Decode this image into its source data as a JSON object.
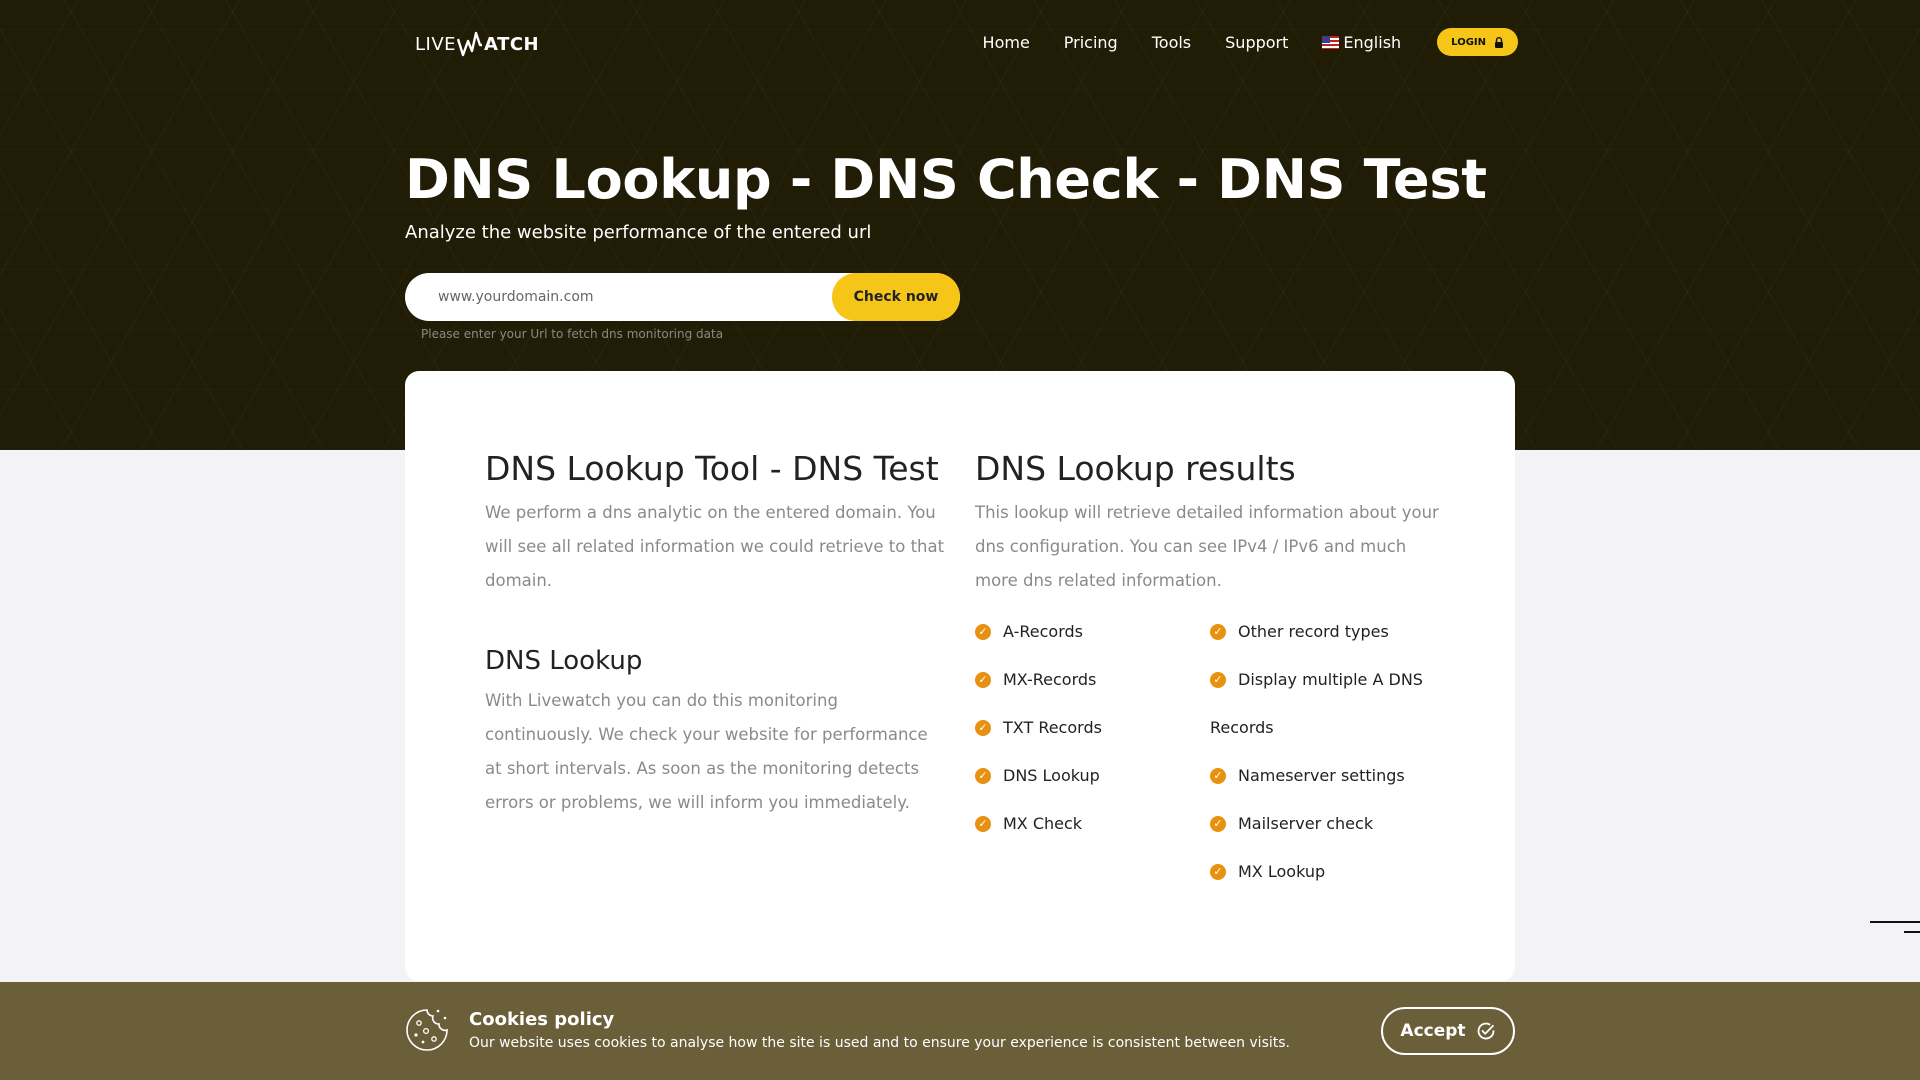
{
  "header": {
    "logo": {
      "part1": "LIVE",
      "part2": "ATCH"
    },
    "nav": [
      "Home",
      "Pricing",
      "Tools",
      "Support"
    ],
    "language": "English",
    "login_label": "LOGIN"
  },
  "hero": {
    "title": "DNS Lookup - DNS Check - DNS Test",
    "subtitle": "Analyze the website performance of the entered url",
    "search_placeholder": "www.yourdomain.com",
    "check_button": "Check now",
    "hint": "Please enter your Url to fetch dns monitoring data"
  },
  "left": {
    "title": "DNS Lookup Tool - DNS Test",
    "text": "We perform a dns analytic on the entered domain. You will see all related information we could retrieve to that domain.",
    "subtitle": "DNS Lookup",
    "subtext": "With Livewatch you can do this monitoring continuously. We check your website for performance at short intervals. As soon as the monitoring detects errors or problems, we will inform you immediately."
  },
  "right": {
    "title": "DNS Lookup results",
    "text": "This lookup will retrieve detailed information about your dns configuration. You can see IPv4 / IPv6 and much more dns related information.",
    "features_col1": [
      "A-Records",
      "MX-Records",
      "TXT Records",
      "DNS Lookup",
      "MX Check"
    ],
    "features_col2": [
      "Other record types",
      "Display multiple A DNS Records",
      "Nameserver settings",
      "Mailserver check",
      "MX Lookup"
    ]
  },
  "cookie": {
    "title": "Cookies policy",
    "text": "Our website uses cookies to analyse how the site is used and to ensure your experience is consistent between visits.",
    "accept": "Accept"
  },
  "colors": {
    "accent": "#f5c518",
    "hero_bg": "#211c05",
    "check": "#e89110",
    "cookie_bg": "#6b5f3a"
  }
}
